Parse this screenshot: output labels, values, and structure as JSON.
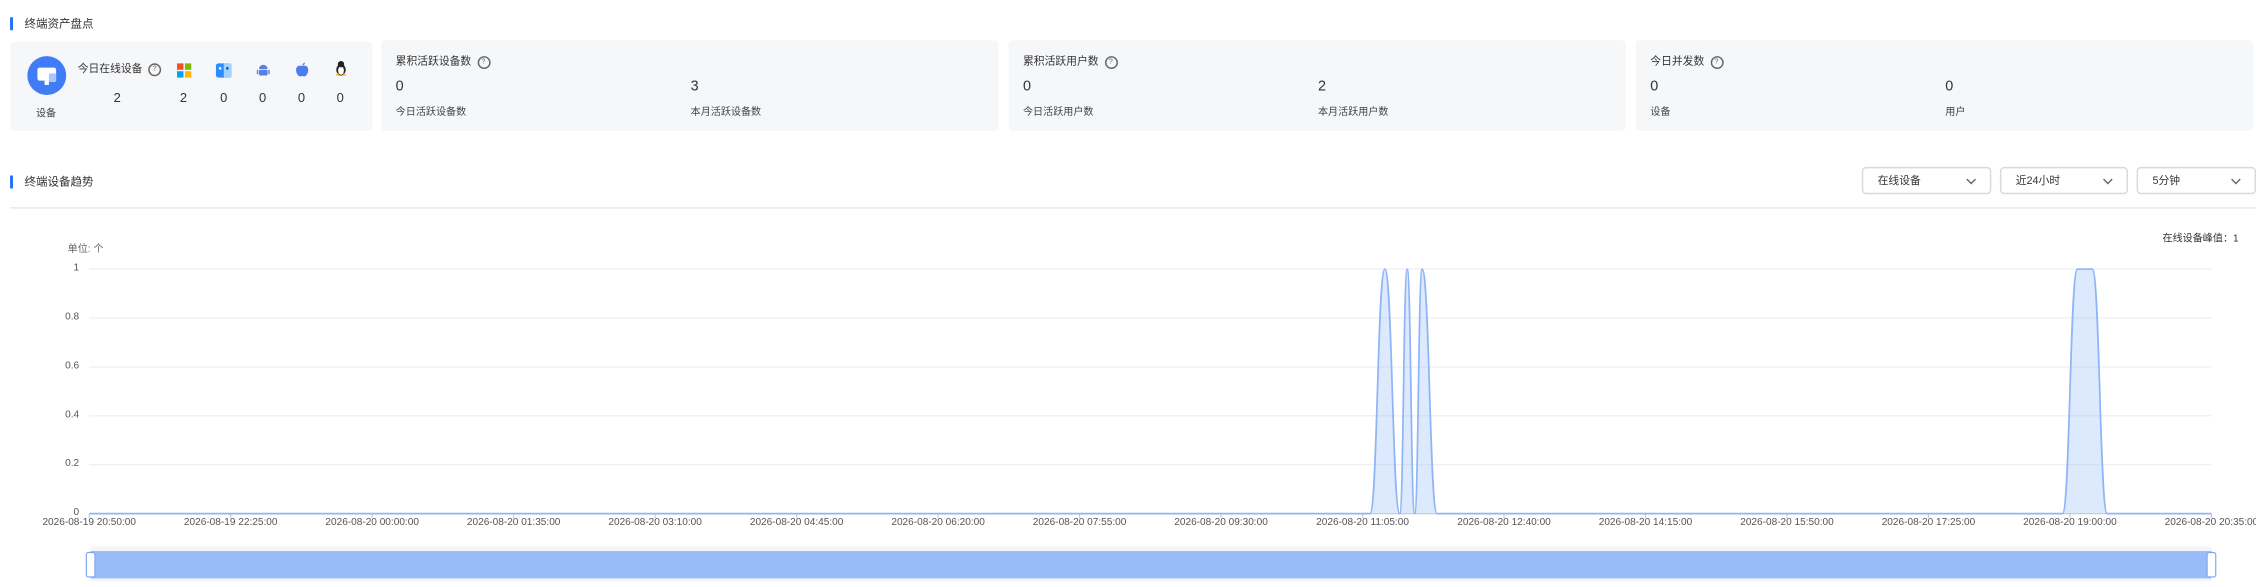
{
  "assets": {
    "title": "终端资产盘点",
    "online": {
      "device_icon": "monitor-device-icon",
      "device_label": "设备",
      "title": "今日在线设备",
      "total": "2",
      "os": [
        {
          "icon": "windows-icon",
          "value": "2",
          "color": "#f25022"
        },
        {
          "icon": "finder-icon",
          "value": "0",
          "color": "#2b8cff"
        },
        {
          "icon": "android-icon",
          "value": "0",
          "color": "#5b7fe0"
        },
        {
          "icon": "apple-icon",
          "value": "0",
          "color": "#4a7df0"
        },
        {
          "icon": "linux-icon",
          "value": "0",
          "color": "#222222"
        }
      ]
    },
    "active_devices": {
      "title": "累积活跃设备数",
      "today_value": "0",
      "today_label": "今日活跃设备数",
      "month_value": "3",
      "month_label": "本月活跃设备数"
    },
    "active_users": {
      "title": "累积活跃用户数",
      "today_value": "0",
      "today_label": "今日活跃用户数",
      "month_value": "2",
      "month_label": "本月活跃用户数"
    },
    "concurrency": {
      "title": "今日并发数",
      "device_value": "0",
      "device_label": "设备",
      "user_value": "0",
      "user_label": "用户"
    }
  },
  "trend": {
    "title": "终端设备趋势",
    "filters": {
      "metric": "在线设备",
      "range": "近24小时",
      "interval": "5分钟"
    },
    "unit": "单位: 个",
    "peak": "在线设备峰值：1"
  },
  "chart_data": {
    "type": "area",
    "ylim": [
      0,
      1
    ],
    "yticks": [
      "0",
      "0.2",
      "0.4",
      "0.6",
      "0.8",
      "1"
    ],
    "xticks": [
      "2026-08-19 20:50:00",
      "2026-08-19 22:25:00",
      "2026-08-20 00:00:00",
      "2026-08-20 01:35:00",
      "2026-08-20 03:10:00",
      "2026-08-20 04:45:00",
      "2026-08-20 06:20:00",
      "2026-08-20 07:55:00",
      "2026-08-20 09:30:00",
      "2026-08-20 11:05:00",
      "2026-08-20 12:40:00",
      "2026-08-20 14:15:00",
      "2026-08-20 15:50:00",
      "2026-08-20 17:25:00",
      "2026-08-20 19:00:00",
      "2026-08-20 20:35:00"
    ],
    "series": [
      {
        "color": "#8fb5f6",
        "points": [
          [
            "2026-08-19 20:50:00",
            0
          ],
          [
            "2026-08-20 11:10:00",
            0
          ],
          [
            "2026-08-20 11:20:00",
            1
          ],
          [
            "2026-08-20 11:30:00",
            0
          ],
          [
            "2026-08-20 11:35:00",
            1
          ],
          [
            "2026-08-20 11:40:00",
            0
          ],
          [
            "2026-08-20 11:45:00",
            1
          ],
          [
            "2026-08-20 11:55:00",
            0
          ],
          [
            "2026-08-20 18:55:00",
            0
          ],
          [
            "2026-08-20 19:05:00",
            1
          ],
          [
            "2026-08-20 19:15:00",
            1
          ],
          [
            "2026-08-20 19:25:00",
            0
          ],
          [
            "2026-08-20 20:35:00",
            0
          ]
        ]
      }
    ]
  }
}
